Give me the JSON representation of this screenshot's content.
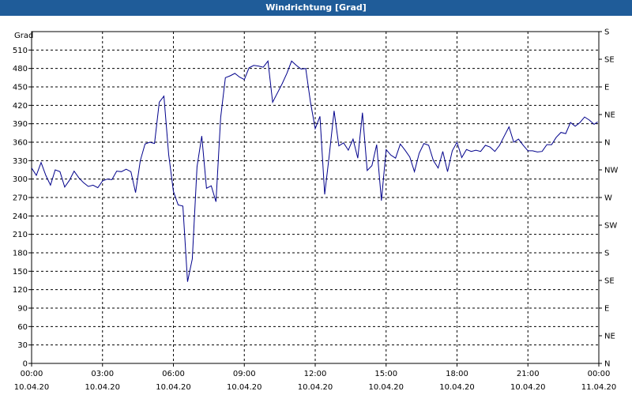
{
  "window_title": "Windrichtung [Grad]",
  "chart_data": {
    "type": "line",
    "title": "Windrichtung [Grad]",
    "ylabel": "Grad",
    "ylim": [
      0,
      540
    ],
    "y_ticks": [
      0,
      30,
      60,
      90,
      120,
      150,
      180,
      210,
      240,
      270,
      300,
      330,
      360,
      390,
      420,
      450,
      480,
      510
    ],
    "right_ticks": [
      "N",
      "NE",
      "E",
      "SE",
      "S",
      "SW",
      "W",
      "NW",
      "N",
      "NE",
      "E",
      "SE",
      "S"
    ],
    "xlim_hours": [
      0,
      24
    ],
    "x_ticks": [
      {
        "time": "00:00",
        "date": "10.04.20"
      },
      {
        "time": "03:00",
        "date": "10.04.20"
      },
      {
        "time": "06:00",
        "date": "10.04.20"
      },
      {
        "time": "09:00",
        "date": "10.04.20"
      },
      {
        "time": "12:00",
        "date": "10.04.20"
      },
      {
        "time": "15:00",
        "date": "10.04.20"
      },
      {
        "time": "18:00",
        "date": "10.04.20"
      },
      {
        "time": "21:00",
        "date": "10.04.20"
      },
      {
        "time": "00:00",
        "date": "11.04.20"
      }
    ],
    "grid": true,
    "series_color": "#00008b",
    "x": [
      0,
      0.2,
      0.4,
      0.6,
      0.8,
      1.0,
      1.2,
      1.4,
      1.6,
      1.8,
      2.0,
      2.2,
      2.4,
      2.6,
      2.8,
      3.0,
      3.2,
      3.4,
      3.6,
      3.8,
      4.0,
      4.2,
      4.4,
      4.6,
      4.8,
      5.0,
      5.2,
      5.4,
      5.6,
      5.8,
      6.0,
      6.2,
      6.4,
      6.6,
      6.8,
      7.0,
      7.2,
      7.4,
      7.6,
      7.8,
      8.0,
      8.2,
      8.4,
      8.6,
      8.8,
      9.0,
      9.2,
      9.4,
      9.6,
      9.8,
      10.0,
      10.2,
      10.4,
      10.6,
      10.8,
      11.0,
      11.2,
      11.4,
      11.6,
      11.8,
      12.0,
      12.2,
      12.4,
      12.6,
      12.8,
      13.0,
      13.2,
      13.4,
      13.6,
      13.8,
      14.0,
      14.2,
      14.4,
      14.6,
      14.8,
      15.0,
      15.2,
      15.4,
      15.6,
      15.8,
      16.0,
      16.2,
      16.4,
      16.6,
      16.8,
      17.0,
      17.2,
      17.4,
      17.6,
      17.8,
      18.0,
      18.2,
      18.4,
      18.6,
      18.8,
      19.0,
      19.2,
      19.4,
      19.6,
      19.8,
      20.0,
      20.2,
      20.4,
      20.6,
      20.8,
      21.0,
      21.2,
      21.4,
      21.6,
      21.8,
      22.0,
      22.2,
      22.4,
      22.6,
      22.8,
      23.0,
      23.2,
      23.4,
      23.6,
      23.8,
      23.95
    ],
    "values": [
      318,
      306,
      327,
      306,
      290,
      315,
      312,
      287,
      298,
      313,
      302,
      294,
      288,
      290,
      286,
      297,
      300,
      299,
      313,
      312,
      316,
      312,
      278,
      330,
      357,
      360,
      358,
      425,
      435,
      340,
      280,
      258,
      256,
      133,
      170,
      320,
      370,
      285,
      289,
      263,
      400,
      465,
      468,
      472,
      466,
      462,
      481,
      485,
      484,
      482,
      492,
      425,
      440,
      455,
      472,
      492,
      485,
      479,
      480,
      425,
      382,
      402,
      275,
      340,
      411,
      354,
      359,
      347,
      365,
      334,
      408,
      314,
      322,
      356,
      265,
      348,
      339,
      334,
      357,
      347,
      336,
      312,
      342,
      358,
      355,
      330,
      318,
      345,
      312,
      346,
      360,
      335,
      348,
      345,
      347,
      345,
      355,
      352,
      345,
      355,
      370,
      385,
      360,
      365,
      355,
      346,
      346,
      344,
      345,
      356,
      356,
      368,
      376,
      374,
      392,
      386,
      392,
      401,
      396,
      389,
      393,
      391,
      387,
      383,
      381,
      386,
      396,
      393,
      380,
      384,
      375,
      372,
      360,
      358,
      365,
      373,
      370,
      373,
      373
    ]
  }
}
